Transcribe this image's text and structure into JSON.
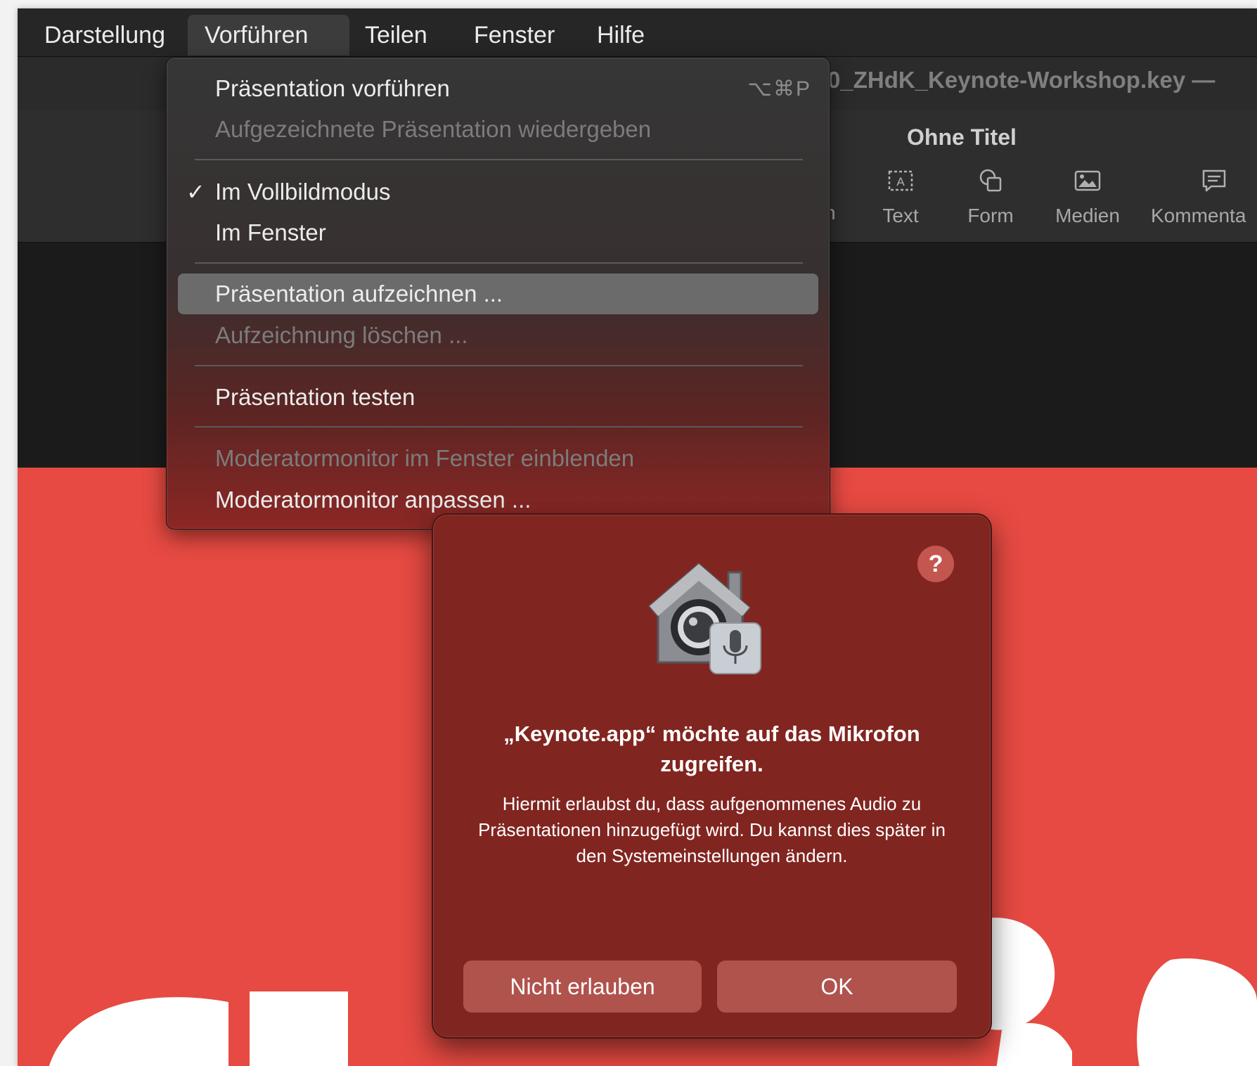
{
  "menubar": {
    "items": [
      "Darstellung",
      "Vorführen",
      "Teilen",
      "Fenster",
      "Hilfe"
    ],
    "active": "Vorführen"
  },
  "window": {
    "doc_title": "0_ZHdK_Keynote-Workshop.key —",
    "toolbar_title": "Ohne Titel",
    "partial_label": "n",
    "toolbar_buttons": [
      {
        "label": "Text",
        "icon": "text-box-icon"
      },
      {
        "label": "Form",
        "icon": "shape-icon"
      },
      {
        "label": "Medien",
        "icon": "media-icon"
      },
      {
        "label": "Kommenta",
        "icon": "comment-icon"
      }
    ]
  },
  "menu": {
    "items": [
      {
        "label": "Präsentation vorführen",
        "shortcut": "⌥⌘P",
        "enabled": true
      },
      {
        "label": "Aufgezeichnete Präsentation wiedergeben",
        "enabled": false
      },
      {
        "label": "Im Vollbildmodus",
        "checked": true,
        "check": "✓",
        "enabled": true
      },
      {
        "label": "Im Fenster",
        "enabled": true
      },
      {
        "label": "Präsentation aufzeichnen ...",
        "enabled": true,
        "highlighted": true
      },
      {
        "label": "Aufzeichnung löschen ...",
        "enabled": false
      },
      {
        "label": "Präsentation testen",
        "enabled": true
      },
      {
        "label": "Moderatormonitor im Fenster einblenden",
        "enabled": false
      },
      {
        "label": "Moderatormonitor anpassen ...",
        "enabled": true
      }
    ]
  },
  "dialog": {
    "icon": "privacy-microphone-icon",
    "help": "?",
    "title": "„Keynote.app“ möchte auf das Mikrofon zugreifen.",
    "message": "Hiermit erlaubst du, dass aufgenommenes Audio zu Präsentationen hinzugefügt wird. Du kannst dies später in den Systemeinstellungen ändern.",
    "deny_label": "Nicht erlauben",
    "ok_label": "OK"
  },
  "colors": {
    "slide_background": "#e64a42",
    "dialog_background": "#812520",
    "menu_highlight": "#6b6b6b"
  }
}
